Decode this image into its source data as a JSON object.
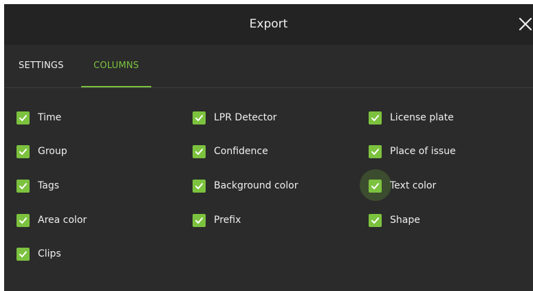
{
  "dialog": {
    "title": "Export",
    "close_icon": "close-icon"
  },
  "tabs": [
    {
      "label": "SETTINGS",
      "active": false
    },
    {
      "label": "COLUMNS",
      "active": true
    }
  ],
  "colors": {
    "accent": "#7cc23f",
    "background": "#2b2b2b",
    "titlebar": "#232323",
    "text": "#f0f0f0"
  },
  "columns": {
    "col1": [
      {
        "label": "Time",
        "checked": true
      },
      {
        "label": "Group",
        "checked": true
      },
      {
        "label": "Tags",
        "checked": true
      },
      {
        "label": "Area color",
        "checked": true
      },
      {
        "label": "Clips",
        "checked": true
      }
    ],
    "col2": [
      {
        "label": "LPR Detector",
        "checked": true
      },
      {
        "label": "Confidence",
        "checked": true
      },
      {
        "label": "Background color",
        "checked": true
      },
      {
        "label": "Prefix",
        "checked": true
      }
    ],
    "col3": [
      {
        "label": "License plate",
        "checked": true
      },
      {
        "label": "Place of issue",
        "checked": true
      },
      {
        "label": "Text color",
        "checked": true
      },
      {
        "label": "Shape",
        "checked": true
      }
    ]
  }
}
